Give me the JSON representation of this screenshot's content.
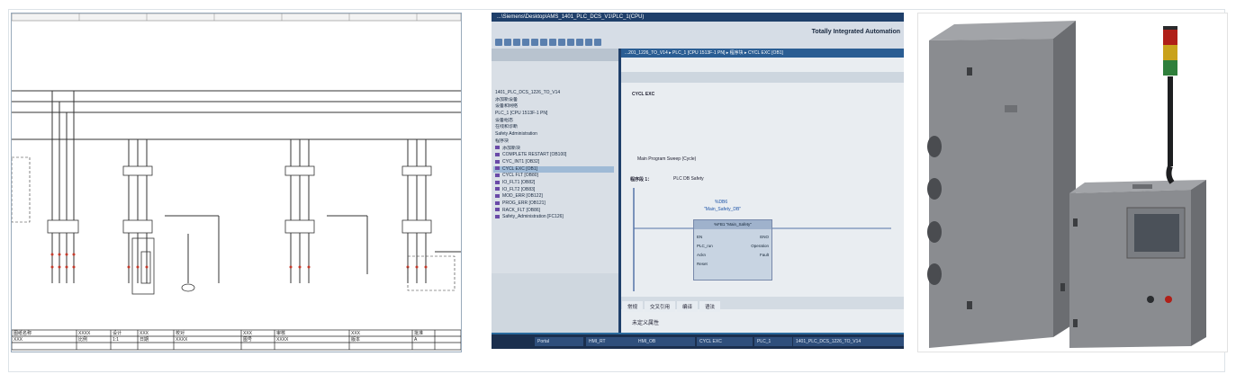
{
  "schematic": {
    "title_block": {
      "cells": [
        "图纸名称",
        "XXXX",
        "设计",
        "XXX",
        "校对",
        "XXX",
        "审核",
        "XXX",
        "批准",
        "XXX",
        "比例",
        "1:1",
        "日期",
        "XXXX",
        "图号",
        "XXXX",
        "版本",
        "A"
      ]
    }
  },
  "tia": {
    "window_title": "...\\Siemens\\Desktop\\AMS_1401_PLC_DCS_V1\\PLC_1(CPU)",
    "brand": "Totally Integrated Automation",
    "editor_path": "...201_1226_TO_V14 ▸ PLC_1 [CPU 1513F-1 PN] ▸ 程序块 ▸ CYCL EXC [OB1]",
    "tree_items": [
      "1401_PLC_DCS_1226_TO_V14",
      "添加新设备",
      "设备和网络",
      "PLC_1 [CPU 1513F-1 PN]",
      "设备组态",
      "在线和诊断",
      "Safety Administration",
      "程序块",
      "添加新块",
      "COMPLETE RESTART [OB100]",
      "CYC_INT1 [OB32]",
      "CYCL EXC [OB1]",
      "CYCL FLT [OB80]",
      "IO_FLT1 [OB82]",
      "IO_FLT2 [OB83]",
      "MOD_ERR [OB122]",
      "PROG_ERR [OB121]",
      "RACK_FLT [OB86]",
      "Safety_Administration [FC126]"
    ],
    "selected_tree_index": 11,
    "block_title": "CYCL EXC",
    "network1_title": "程序段 1：",
    "network1_comment": "PLC DB Safety",
    "block_header_top": "%DB6",
    "block_header_name": "\"Main_Safety_DB\"",
    "block_fb": "%FB1",
    "block_fb_name": "\"Main_Safety\"",
    "pins_in": [
      "EN",
      "PLC_run",
      "Ackn",
      "Reset"
    ],
    "pins_out": [
      "ENO",
      "Operation",
      "Fault"
    ],
    "block_comment": "Main Program Sweep (Cycle)",
    "tabs": [
      "常规",
      "交叉引用",
      "编译",
      "语法"
    ],
    "inspector_label": "未定义属性",
    "taskbar": [
      "Portal",
      "HMI_RT",
      "HMI_OB",
      "CYCL EXC",
      "PLC_1",
      "1401_PLC_DCS_1226_TO_V14"
    ]
  },
  "render": {
    "description_colors": {
      "box_front": "#8a8c90",
      "box_side": "#6b6d71",
      "box_top": "#a2a4a8",
      "screen": "#4b5159",
      "light_red": "#b01f18",
      "light_yellow": "#c9a21c",
      "light_green": "#2f7f3b"
    }
  }
}
